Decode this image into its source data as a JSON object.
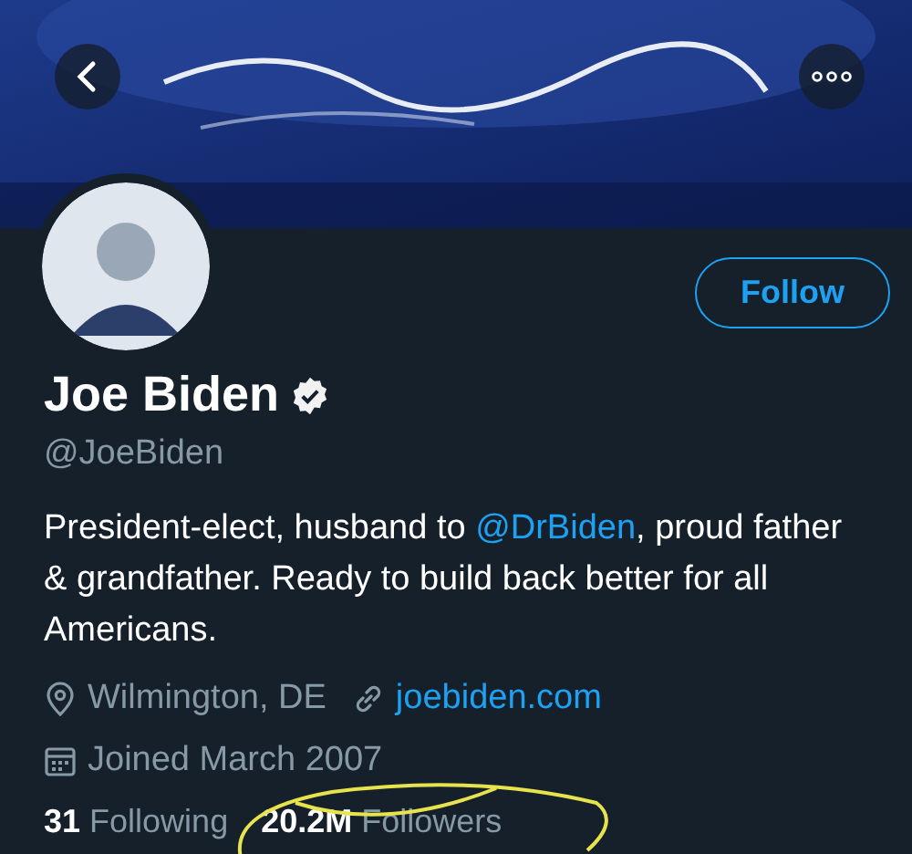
{
  "profile": {
    "name": "Joe Biden",
    "verified": true,
    "handle": "@JoeBiden"
  },
  "follow_button": "Follow",
  "bio": {
    "before": "President-elect, husband to ",
    "mention": "@DrBiden",
    "after": ", proud father & grandfather. Ready to build back better for all Americans."
  },
  "location": "Wilmington, DE",
  "website": "joebiden.com",
  "joined": "Joined March 2007",
  "stats": [
    {
      "count": "31",
      "label": "Following"
    },
    {
      "count": "20.2M",
      "label": "Followers"
    }
  ]
}
